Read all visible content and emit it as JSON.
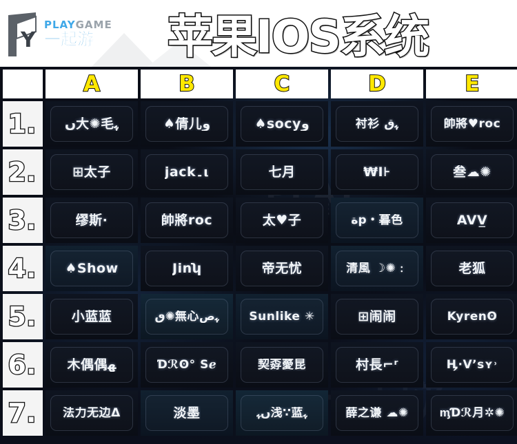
{
  "banner": {
    "title": "苹果IOS系统",
    "logo": {
      "play": "PLAY",
      "game": "GAME",
      "cn": "一起游",
      "mark": "Y"
    }
  },
  "grid": {
    "corner_label": "",
    "columns": [
      "A",
      "B",
      "C",
      "D",
      "E"
    ],
    "row_labels": [
      "1.",
      "2.",
      "3.",
      "4.",
      "5.",
      "6.",
      "7."
    ],
    "rows": [
      {
        "label": "1.",
        "cells": [
          {
            "text": "ں大✺毛ﮩ",
            "tint": "tint-a",
            "size": ""
          },
          {
            "text": "♠倩儿و",
            "tint": "tint-a",
            "size": ""
          },
          {
            "text": "♠socyو",
            "tint": "tint-a",
            "size": ""
          },
          {
            "text": "衬衫 ﮩق",
            "tint": "tint-a",
            "size": "sm"
          },
          {
            "text": "帥將♥roc",
            "tint": "tint-a",
            "size": "sm"
          }
        ]
      },
      {
        "label": "2.",
        "cells": [
          {
            "text": "⊞太子",
            "tint": "tint-a",
            "size": ""
          },
          {
            "text": "jack۔ι",
            "tint": "tint-a",
            "size": ""
          },
          {
            "text": "七月",
            "tint": "tint-a",
            "size": ""
          },
          {
            "text": "₩I⊦",
            "tint": "tint-a",
            "size": ""
          },
          {
            "text": "叁☁✺",
            "tint": "tint-a",
            "size": ""
          }
        ]
      },
      {
        "label": "3.",
        "cells": [
          {
            "text": "缪斯·",
            "tint": "tint-a",
            "size": ""
          },
          {
            "text": "帥將roc",
            "tint": "tint-a",
            "size": ""
          },
          {
            "text": "太♥子",
            "tint": "tint-a",
            "size": ""
          },
          {
            "text": "ةp・暮色",
            "tint": "tint-b",
            "size": "sm"
          },
          {
            "text": "AVV̲",
            "tint": "tint-a",
            "size": ""
          }
        ]
      },
      {
        "label": "4.",
        "cells": [
          {
            "text": "♠Show",
            "tint": "tint-b",
            "size": ""
          },
          {
            "text": "Jinʮ",
            "tint": "tint-a",
            "size": ""
          },
          {
            "text": "帝无忧",
            "tint": "tint-a",
            "size": ""
          },
          {
            "text": "清風 ☽✺﹕",
            "tint": "tint-b",
            "size": "sm"
          },
          {
            "text": "老狐",
            "tint": "tint-a",
            "size": ""
          }
        ]
      },
      {
        "label": "5.",
        "cells": [
          {
            "text": "小蓝蓝",
            "tint": "tint-a",
            "size": ""
          },
          {
            "text": "ٯ✺無心ﮩص",
            "tint": "tint-c",
            "size": "sm"
          },
          {
            "text": "Sunlike ✳",
            "tint": "tint-b",
            "size": "sm"
          },
          {
            "text": "⊞闹闹",
            "tint": "tint-a",
            "size": ""
          },
          {
            "text": "Kyrenʘ",
            "tint": "tint-a",
            "size": "sm"
          }
        ]
      },
      {
        "label": "6.",
        "cells": [
          {
            "text": "木偶偶ﮭ",
            "tint": "tint-a",
            "size": ""
          },
          {
            "text": "Ɗℛʘ° Sℯ",
            "tint": "tint-a",
            "size": "sm"
          },
          {
            "text": "契孬薆昆",
            "tint": "tint-a",
            "size": "sm"
          },
          {
            "text": "村長⌐ʳ",
            "tint": "tint-a",
            "size": ""
          },
          {
            "text": "Ӊ·Vʼsʏ˒",
            "tint": "tint-a",
            "size": "sm"
          }
        ]
      },
      {
        "label": "7.",
        "cells": [
          {
            "text": "法力无边Δ",
            "tint": "tint-a",
            "size": "sm"
          },
          {
            "text": "淡墨",
            "tint": "tint-b",
            "size": ""
          },
          {
            "text": "ںﮩ浅∵蓝ﮩ",
            "tint": "tint-c",
            "size": "sm"
          },
          {
            "text": "薛之谦 ☁✺",
            "tint": "tint-a",
            "size": "sm"
          },
          {
            "text": "ᶆƊℛ月✲✺",
            "tint": "tint-a",
            "size": "sm"
          }
        ]
      }
    ]
  },
  "watermarks": {
    "line1": "PLAY",
    "line2": "GAME",
    "line3": "一起游"
  },
  "colors": {
    "grid_line": "#ff1f1f",
    "column_letter": "#ffe800",
    "cell_bg": "#0b0e17",
    "logo_blue": "#2b9ae0"
  }
}
